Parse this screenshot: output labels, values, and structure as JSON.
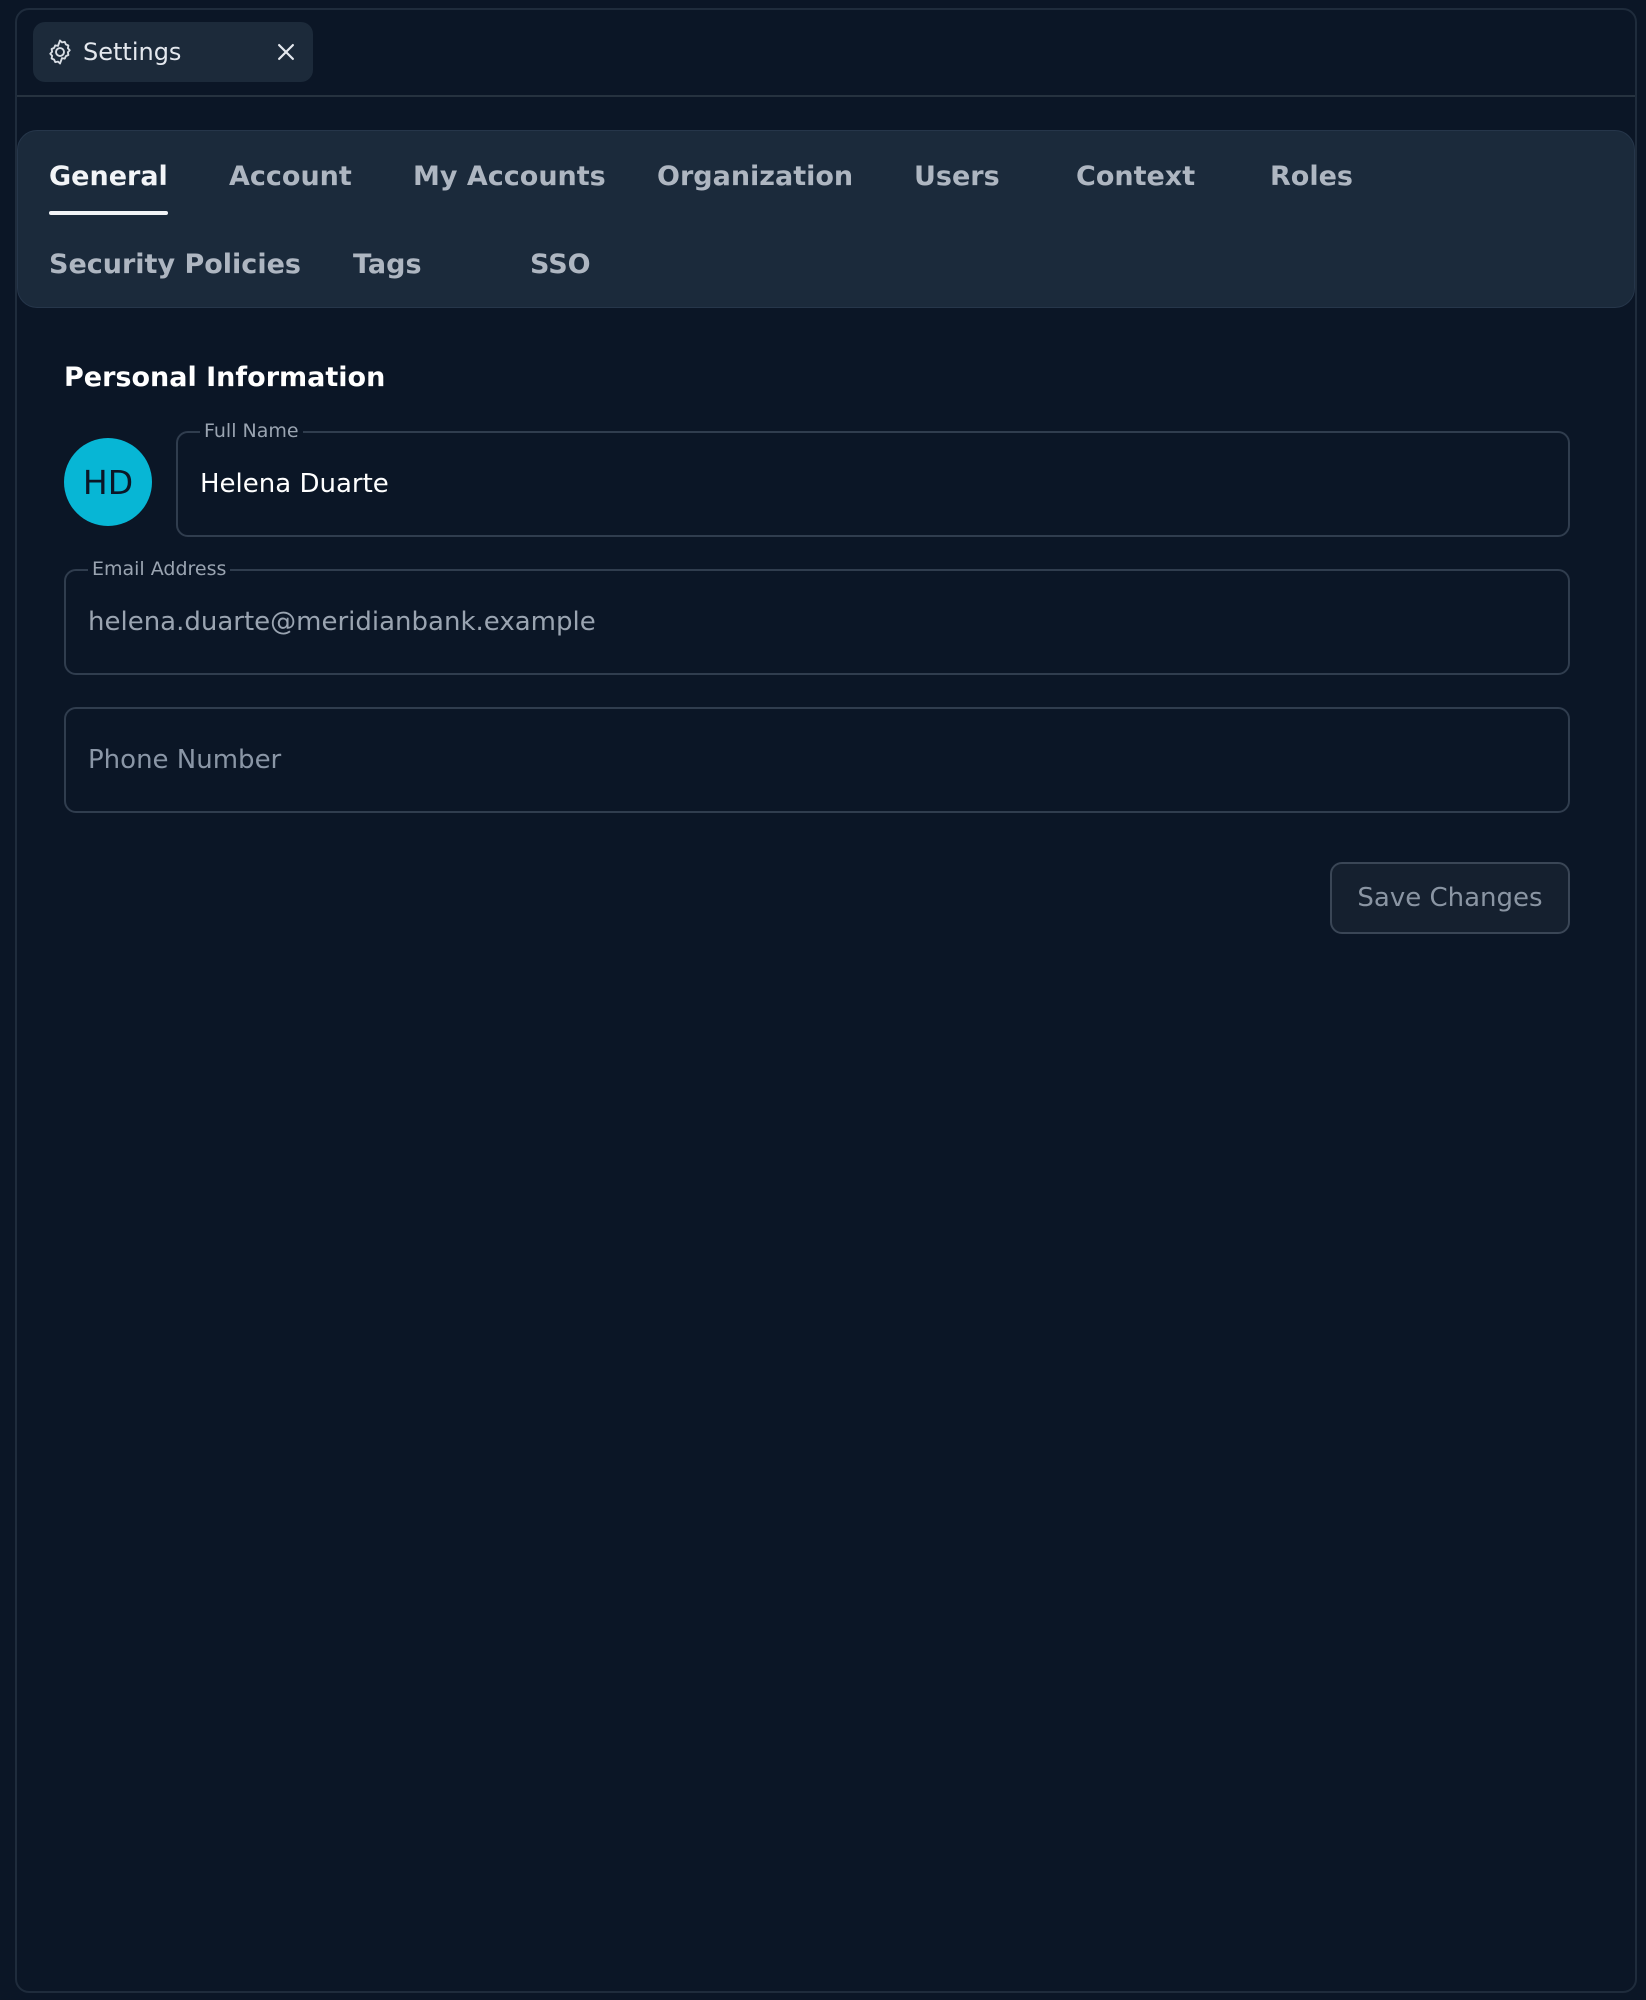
{
  "window_tab": {
    "title": "Settings",
    "icon": "gear-icon",
    "close_icon": "close-icon"
  },
  "tabs": [
    {
      "label": "General",
      "active": true
    },
    {
      "label": "Account",
      "active": false
    },
    {
      "label": "My Accounts",
      "active": false
    },
    {
      "label": "Organization",
      "active": false
    },
    {
      "label": "Users",
      "active": false
    },
    {
      "label": "Context",
      "active": false
    },
    {
      "label": "Roles",
      "active": false
    },
    {
      "label": "Security Policies",
      "active": false
    },
    {
      "label": "Tags",
      "active": false
    },
    {
      "label": "SSO",
      "active": false
    }
  ],
  "personal_info": {
    "title": "Personal Information",
    "avatar_initials": "HD",
    "avatar_color": "#07b6d5",
    "full_name": {
      "label": "Full Name",
      "value": "Helena Duarte"
    },
    "email": {
      "label": "Email Address",
      "value": "helena.duarte@meridianbank.example"
    },
    "phone": {
      "placeholder": "Phone Number",
      "value": ""
    }
  },
  "actions": {
    "save_label": "Save Changes"
  }
}
